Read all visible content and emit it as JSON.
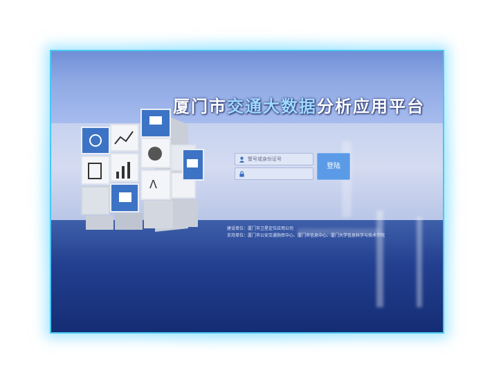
{
  "header": {
    "title_part1": "厦门市",
    "title_highlight": "交通大数据",
    "title_part2": "分析应用平台"
  },
  "login": {
    "username_placeholder": "警号或身份证号",
    "password_placeholder": "",
    "login_label": "登陆"
  },
  "footer": {
    "builder": "建设单位：厦门市卫星定位应用公司",
    "supporter": "支持单位：厦门市公安交通指挥中心、厦门市信息中心、厦门大学信息科学与技术学院"
  },
  "icons": {
    "user": "user-icon",
    "lock": "lock-icon"
  },
  "colors": {
    "accent": "#5b9ae6",
    "frame": "#49c7f2",
    "title_highlight": "#9fd9ff"
  }
}
